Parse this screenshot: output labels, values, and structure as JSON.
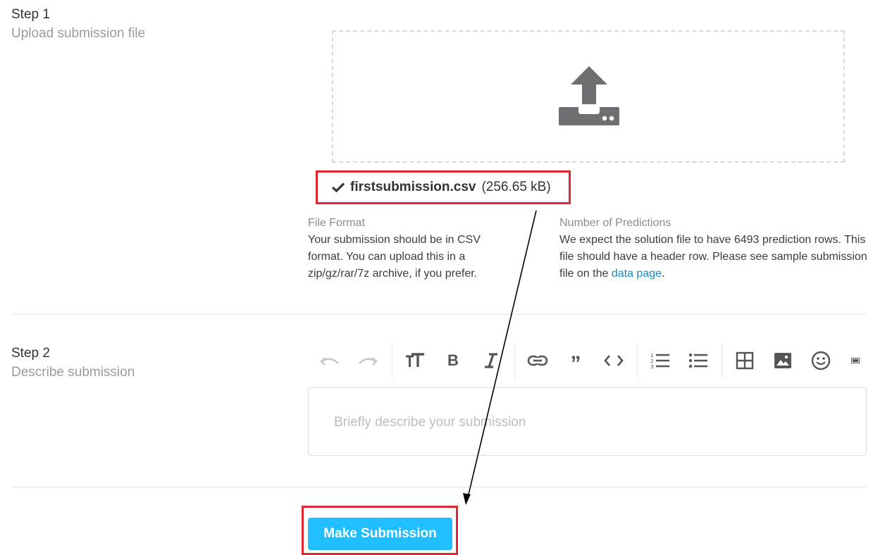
{
  "step1": {
    "title": "Step 1",
    "subtitle": "Upload submission file",
    "uploaded_file": {
      "name": "firstsubmission.csv",
      "size": "(256.65 kB)"
    },
    "file_format": {
      "title": "File Format",
      "body": "Your submission should be in CSV format. You can upload this in a zip/gz/rar/7z archive, if you prefer."
    },
    "num_predictions": {
      "title": "Number of Predictions",
      "body_before_link": "We expect the solution file to have 6493 prediction rows. This file should have a header row. Please see sample submission file on the ",
      "link_text": "data page",
      "body_after_link": "."
    }
  },
  "step2": {
    "title": "Step 2",
    "subtitle": "Describe submission",
    "toolbar_icons": [
      "undo-icon",
      "redo-icon",
      "text-size-icon",
      "bold-icon",
      "italic-icon",
      "link-icon",
      "quote-icon",
      "code-icon",
      "ordered-list-icon",
      "unordered-list-icon",
      "table-icon",
      "image-icon",
      "emoji-icon",
      "markdown-icon"
    ],
    "editor_placeholder": "Briefly describe your submission"
  },
  "submit": {
    "label": "Make Submission"
  },
  "colors": {
    "accent": "#20beff",
    "highlight": "#e0262e",
    "link": "#1a8ab8"
  }
}
